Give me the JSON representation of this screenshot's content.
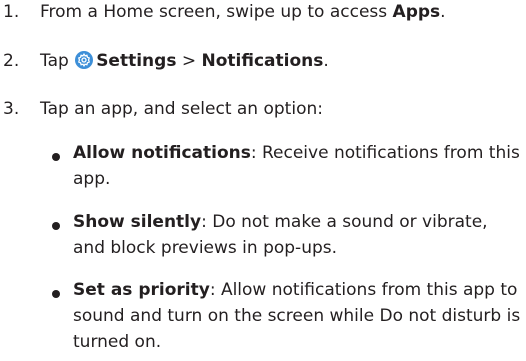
{
  "steps": [
    {
      "number": "1.",
      "prefix": "From a Home screen, swipe up to access ",
      "bold": "Apps",
      "suffix": "."
    },
    {
      "number": "2.",
      "tap_text": "Tap",
      "settings_label": "Settings",
      "separator": ">",
      "notifications_label": "Notifications",
      "suffix": "."
    },
    {
      "number": "3.",
      "text": "Tap an app, and select an option:"
    }
  ],
  "options": [
    {
      "label": "Allow notifications",
      "description": ": Receive notifications from this app."
    },
    {
      "label": "Show silently",
      "description": ": Do not make a sound or vibrate, and block previews in pop-ups."
    },
    {
      "label": "Set as priority",
      "description": ": Allow notifications from this app to sound and turn on the screen while Do not disturb is turned on."
    }
  ],
  "icons": {
    "settings": "gear-icon"
  },
  "colors": {
    "text": "#231f20",
    "settings_icon_bg": "#3d8fd8"
  }
}
